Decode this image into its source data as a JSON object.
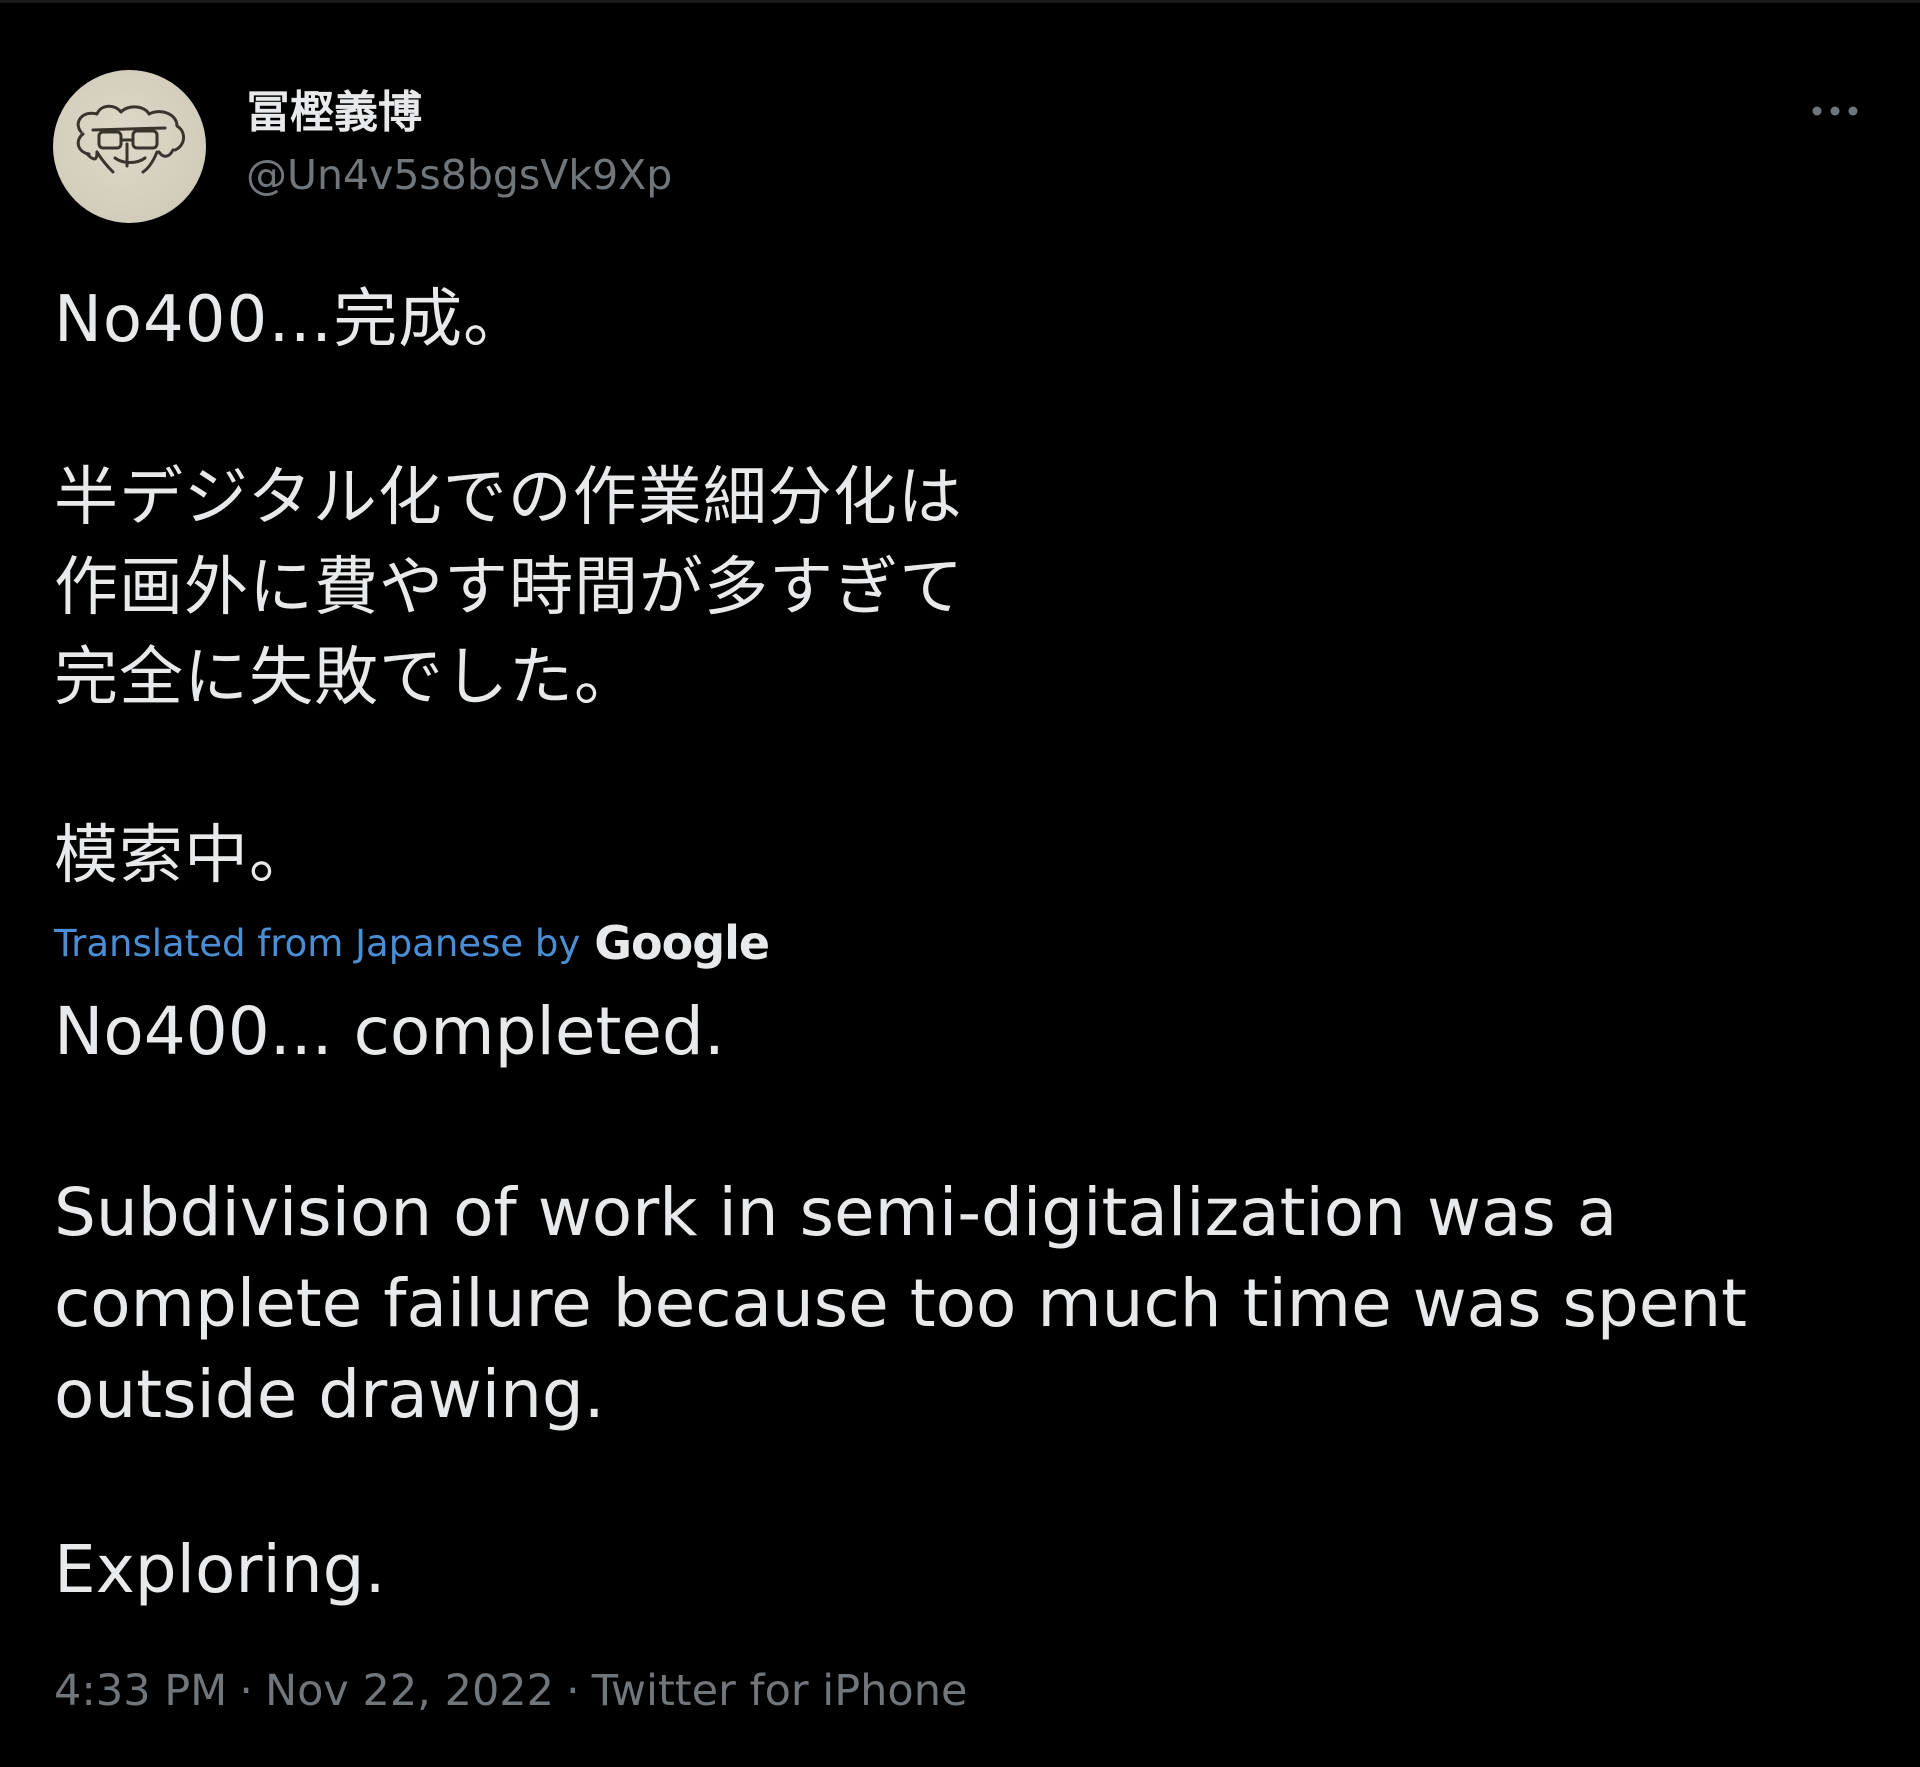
{
  "author": {
    "display_name": "冨樫義博",
    "handle": "@Un4v5s8bgsVk9Xp"
  },
  "more_icon": "ellipsis-icon",
  "original_text": {
    "line1": "No400…完成。",
    "para2": "半デジタル化での作業細分化は\n作画外に費やす時間が多すぎて\n完全に失敗でした。",
    "para3": "模索中。"
  },
  "translation": {
    "label": "Translated from Japanese by",
    "provider": "Google",
    "line1": "No400... completed.",
    "para2": "Subdivision of work in semi-digitalization was a\ncomplete failure because too much time was spent\noutside drawing.",
    "para3": "Exploring."
  },
  "meta": {
    "time": "4:33 PM",
    "separator": "·",
    "date": "Nov 22, 2022",
    "source": "Twitter for iPhone"
  },
  "colors": {
    "background": "#000000",
    "text": "#e7e9ea",
    "secondary": "#71767b",
    "link": "#4a8fd6"
  }
}
